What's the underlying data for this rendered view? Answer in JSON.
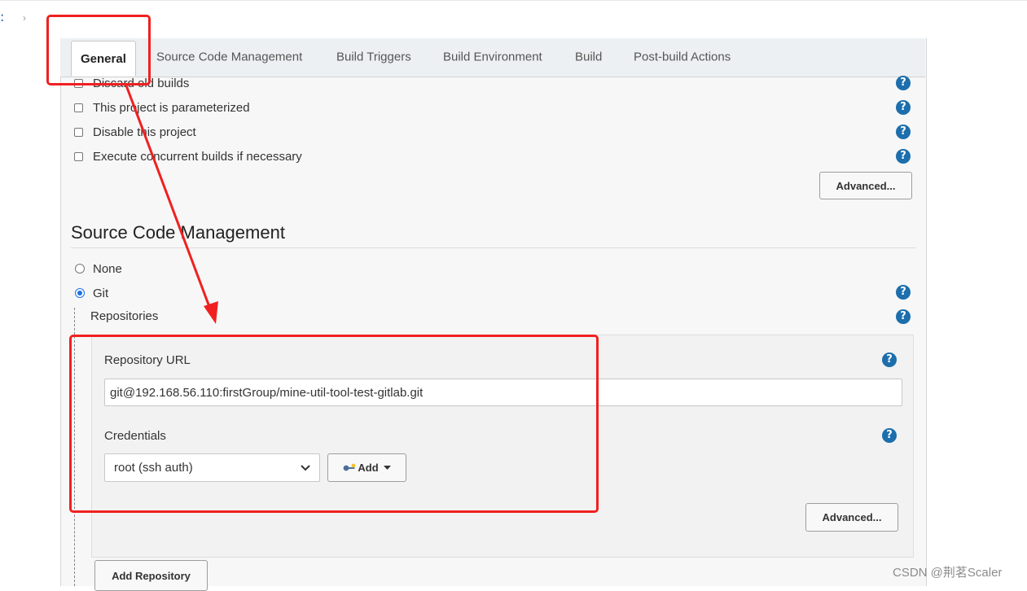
{
  "breadcrumb": {
    "separator": "›"
  },
  "tabs": [
    {
      "label": "General",
      "active": true
    },
    {
      "label": "Source Code Management"
    },
    {
      "label": "Build Triggers"
    },
    {
      "label": "Build Environment"
    },
    {
      "label": "Build"
    },
    {
      "label": "Post-build Actions"
    }
  ],
  "general": {
    "options": [
      {
        "label": "Discard old builds",
        "checked": false
      },
      {
        "label": "This project is parameterized",
        "checked": false
      },
      {
        "label": "Disable this project",
        "checked": false
      },
      {
        "label": "Execute concurrent builds if necessary",
        "checked": false
      }
    ],
    "advanced_label": "Advanced..."
  },
  "scm": {
    "title": "Source Code Management",
    "options": [
      {
        "label": "None",
        "selected": false
      },
      {
        "label": "Git",
        "selected": true
      }
    ],
    "repositories_label": "Repositories",
    "repository_url_label": "Repository URL",
    "repository_url_value": "git@192.168.56.110:firstGroup/mine-util-tool-test-gitlab.git",
    "credentials_label": "Credentials",
    "credentials_selected": "root (ssh auth)",
    "add_label": "Add",
    "repo_advanced_label": "Advanced...",
    "add_repository_label": "Add Repository"
  },
  "help_glyph": "?",
  "icons": {
    "help": "help-icon",
    "key": "key-icon",
    "caret": "caret-down-icon",
    "checkbox": "checkbox-icon",
    "radio": "radio-icon"
  },
  "colors": {
    "help": "#1c6eac",
    "annotation": "#f02020",
    "radio_selected": "#1a73e8"
  },
  "watermark": "CSDN @荆茗Scaler"
}
